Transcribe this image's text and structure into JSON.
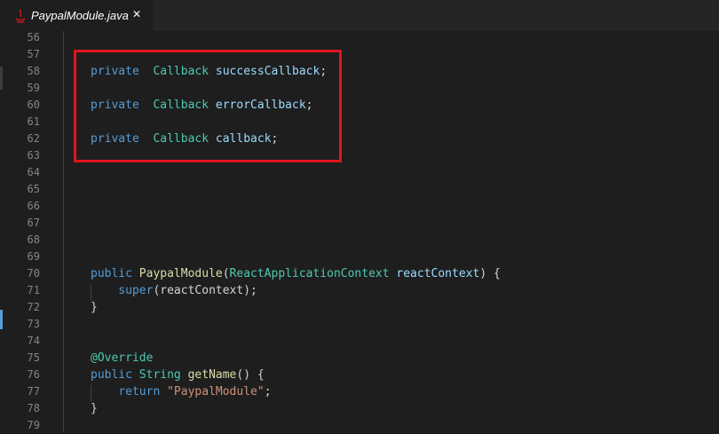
{
  "tab": {
    "title": "PaypalModule.java",
    "close_glyph": "✕",
    "icon": "java-icon",
    "icon_color": "#e0151d"
  },
  "highlight": {
    "color": "#e0151d"
  },
  "lines": [
    {
      "num": "56",
      "tokens": []
    },
    {
      "num": "57",
      "tokens": []
    },
    {
      "num": "58",
      "tokens": [
        {
          "t": "private",
          "c": "kw"
        },
        {
          "t": "  "
        },
        {
          "t": "Callback",
          "c": "ty"
        },
        {
          "t": " "
        },
        {
          "t": "successCallback",
          "c": "var"
        },
        {
          "t": ";"
        }
      ]
    },
    {
      "num": "59",
      "tokens": []
    },
    {
      "num": "60",
      "tokens": [
        {
          "t": "private",
          "c": "kw"
        },
        {
          "t": "  "
        },
        {
          "t": "Callback",
          "c": "ty"
        },
        {
          "t": " "
        },
        {
          "t": "errorCallback",
          "c": "var"
        },
        {
          "t": ";"
        }
      ]
    },
    {
      "num": "61",
      "tokens": []
    },
    {
      "num": "62",
      "tokens": [
        {
          "t": "private",
          "c": "kw"
        },
        {
          "t": "  "
        },
        {
          "t": "Callback",
          "c": "ty"
        },
        {
          "t": " "
        },
        {
          "t": "callback",
          "c": "var"
        },
        {
          "t": ";"
        }
      ]
    },
    {
      "num": "63",
      "tokens": []
    },
    {
      "num": "64",
      "tokens": []
    },
    {
      "num": "65",
      "tokens": []
    },
    {
      "num": "66",
      "tokens": []
    },
    {
      "num": "67",
      "tokens": []
    },
    {
      "num": "68",
      "tokens": []
    },
    {
      "num": "69",
      "tokens": []
    },
    {
      "num": "70",
      "tokens": [
        {
          "t": "public",
          "c": "kw"
        },
        {
          "t": " "
        },
        {
          "t": "PaypalModule",
          "c": "fn"
        },
        {
          "t": "("
        },
        {
          "t": "ReactApplicationContext",
          "c": "ty"
        },
        {
          "t": " "
        },
        {
          "t": "reactContext",
          "c": "var"
        },
        {
          "t": ") {"
        }
      ]
    },
    {
      "num": "71",
      "tokens": [
        {
          "t": "    "
        },
        {
          "t": "super",
          "c": "kw"
        },
        {
          "t": "(reactContext);"
        }
      ]
    },
    {
      "num": "72",
      "tokens": [
        {
          "t": "}"
        }
      ]
    },
    {
      "num": "73",
      "tokens": []
    },
    {
      "num": "74",
      "tokens": []
    },
    {
      "num": "75",
      "tokens": [
        {
          "t": "@Override",
          "c": "ann"
        }
      ]
    },
    {
      "num": "76",
      "tokens": [
        {
          "t": "public",
          "c": "kw"
        },
        {
          "t": " "
        },
        {
          "t": "String",
          "c": "ty"
        },
        {
          "t": " "
        },
        {
          "t": "getName",
          "c": "fn"
        },
        {
          "t": "() {"
        }
      ]
    },
    {
      "num": "77",
      "tokens": [
        {
          "t": "    "
        },
        {
          "t": "return",
          "c": "kw"
        },
        {
          "t": " "
        },
        {
          "t": "\"PaypalModule\"",
          "c": "str"
        },
        {
          "t": ";"
        }
      ]
    },
    {
      "num": "78",
      "tokens": [
        {
          "t": "}"
        }
      ]
    },
    {
      "num": "79",
      "tokens": []
    }
  ]
}
